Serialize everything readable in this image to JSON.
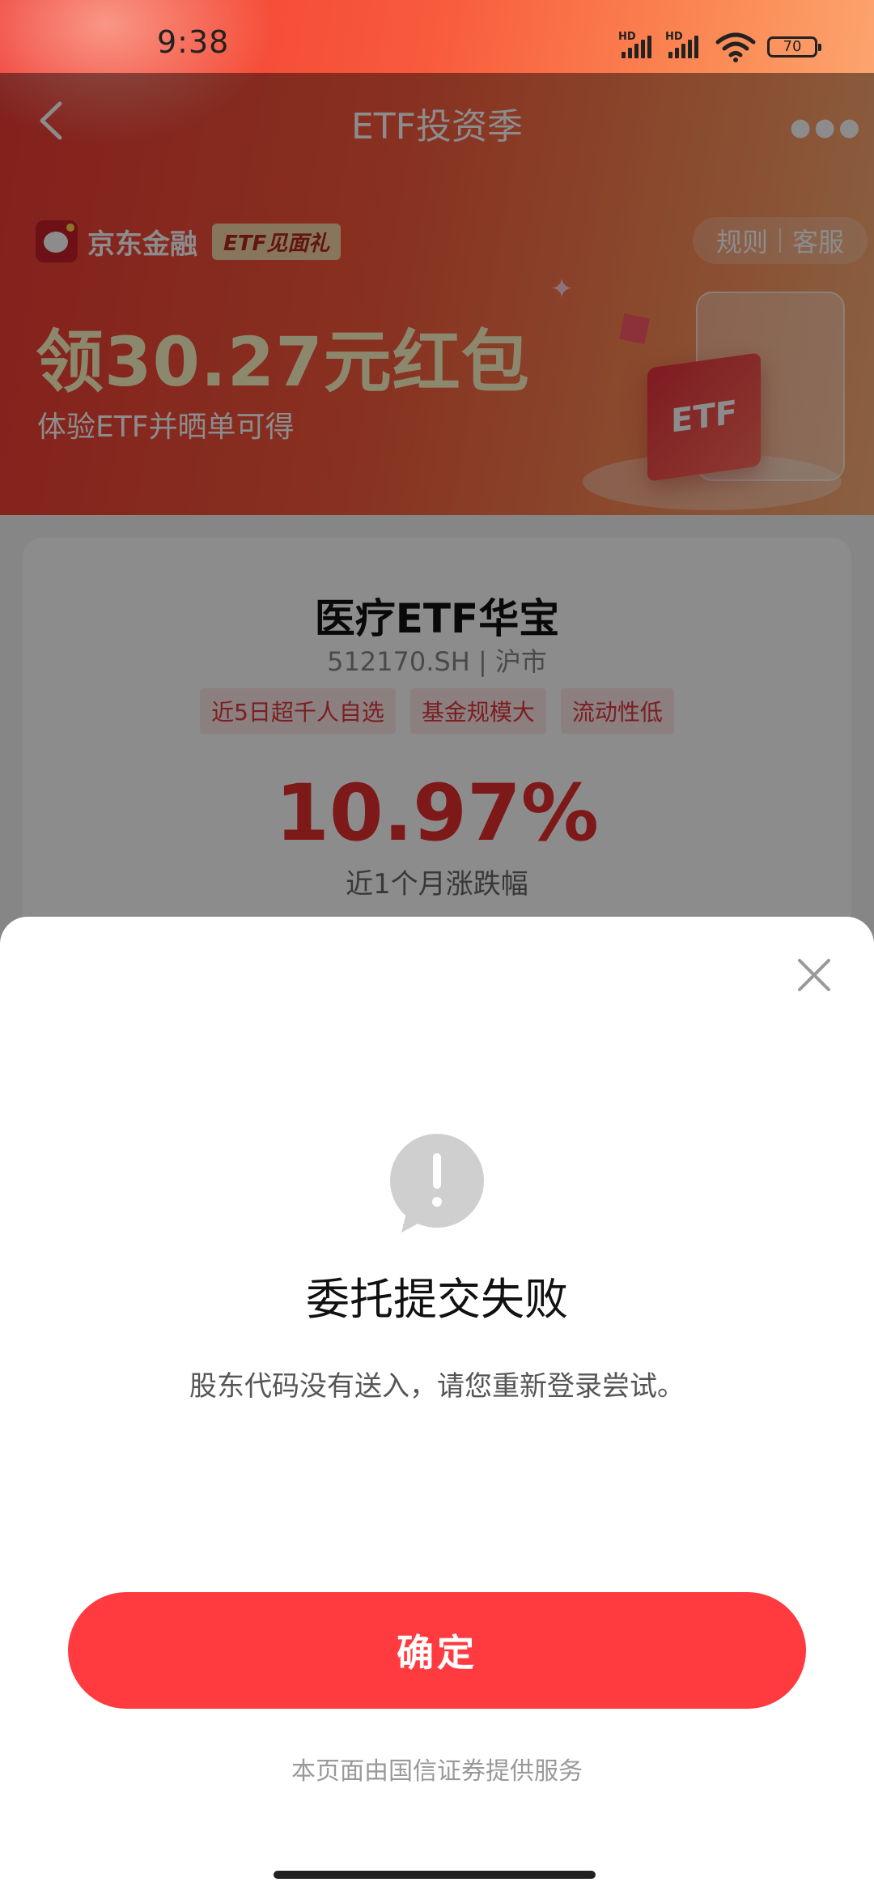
{
  "status_bar": {
    "time": "9:38",
    "signal_labels": [
      "HD",
      "HD"
    ],
    "battery": "70"
  },
  "nav": {
    "title": "ETF投资季",
    "back_icon": "chevron-left-icon",
    "more_icon": "more-dots-icon"
  },
  "hero": {
    "brand_name": "京东金融",
    "brand_tag": "ETF见面礼",
    "rules": "规则",
    "service": "客服",
    "headline": "领30.27元红包",
    "subline": "体验ETF并晒单可得",
    "illustration_text": "ETF"
  },
  "fund": {
    "name": "医疗ETF华宝",
    "code": "512170.SH",
    "market": "沪市",
    "tags": [
      "近5日超千人自选",
      "基金规模大",
      "流动性低"
    ],
    "change": "10.97%",
    "change_label": "近1个月涨跌幅"
  },
  "modal": {
    "title": "委托提交失败",
    "message": "股东代码没有送入，请您重新登录尝试。",
    "confirm": "确定",
    "footer": "本页面由国信证券提供服务"
  },
  "colors": {
    "accent": "#ff3b40",
    "hero_start": "#f03a34",
    "hero_end": "#fcb07a",
    "tag_bg": "#fde8e8",
    "tag_text": "#e0383d"
  }
}
